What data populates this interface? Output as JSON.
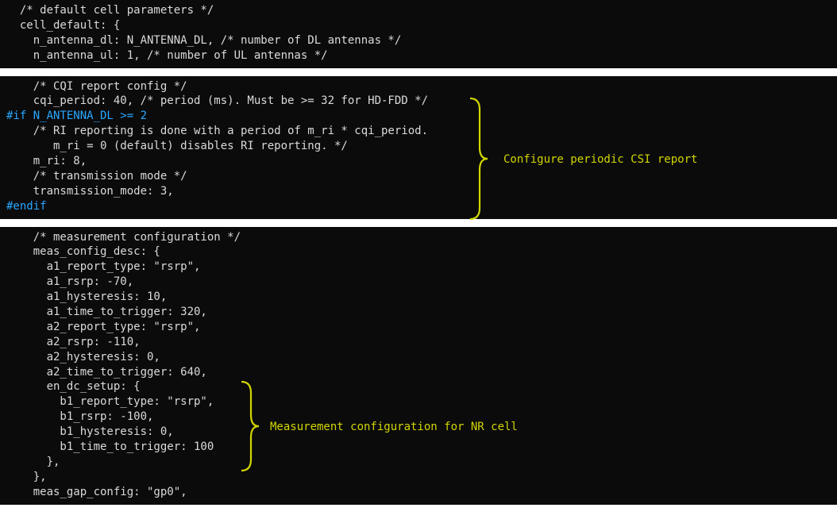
{
  "block1": {
    "l1": "  /* default cell parameters */",
    "l2": "  cell_default: {",
    "l3": "    n_antenna_dl: N_ANTENNA_DL, /* number of DL antennas */",
    "l4": "    n_antenna_ul: 1, /* number of UL antennas */"
  },
  "block2": {
    "l1": "    /* CQI report config */",
    "l2": "    cqi_period: 40, /* period (ms). Must be >= 32 for HD-FDD */",
    "l3": "",
    "l4": "#if N_ANTENNA_DL >= 2",
    "l5": "    /* RI reporting is done with a period of m_ri * cqi_period.",
    "l6": "       m_ri = 0 (default) disables RI reporting. */",
    "l7": "    m_ri: 8,",
    "l8": "    /* transmission mode */",
    "l9": "    transmission_mode: 3,",
    "l10": "#endif",
    "annot": "Configure periodic CSI report"
  },
  "block3": {
    "l1": "    /* measurement configuration */",
    "l2": "    meas_config_desc: {",
    "l3": "      a1_report_type: \"rsrp\",",
    "l4": "      a1_rsrp: -70,",
    "l5": "      a1_hysteresis: 10,",
    "l6": "      a1_time_to_trigger: 320,",
    "l7": "      a2_report_type: \"rsrp\",",
    "l8": "      a2_rsrp: -110,",
    "l9": "      a2_hysteresis: 0,",
    "l10": "      a2_time_to_trigger: 640,",
    "l11": "      en_dc_setup: {",
    "l12": "        b1_report_type: \"rsrp\",",
    "l13": "        b1_rsrp: -100,",
    "l14": "        b1_hysteresis: 0,",
    "l15": "        b1_time_to_trigger: 100",
    "l16": "      },",
    "l17": "    },",
    "l18": "    meas_gap_config: \"gp0\",",
    "annot": "Measurement configuration for NR cell"
  }
}
